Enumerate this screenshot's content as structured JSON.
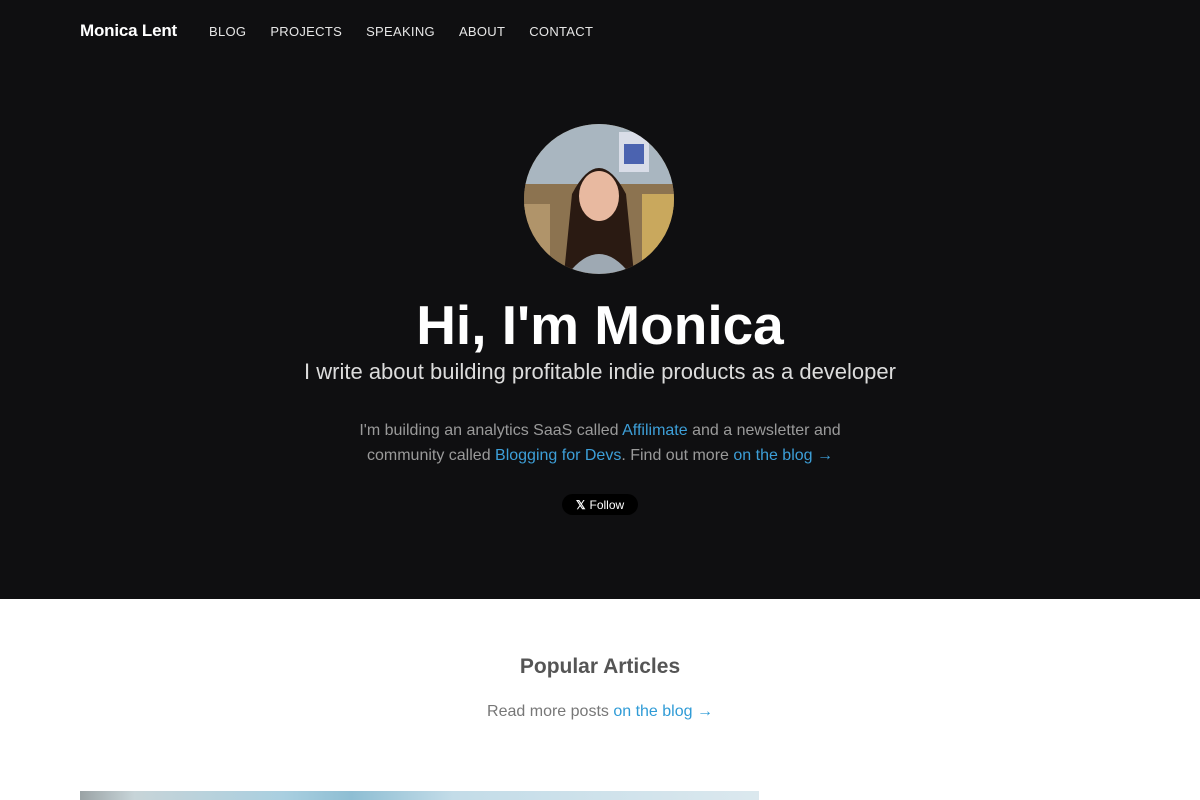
{
  "nav": {
    "brand": "Monica Lent",
    "links": [
      "BLOG",
      "PROJECTS",
      "SPEAKING",
      "ABOUT",
      "CONTACT"
    ]
  },
  "hero": {
    "title": "Hi, I'm Monica",
    "subtitle": "I write about building profitable indie products as a developer",
    "desc": {
      "p1": "I'm building an analytics SaaS called ",
      "link1": "Affilimate",
      "p2": " and a newsletter and community called ",
      "link2": "Blogging for Devs",
      "p3": ". Find out more ",
      "link3": "on the blog →"
    },
    "follow": {
      "icon": "x-logo-icon",
      "glyph": "𝕏",
      "label": "Follow"
    }
  },
  "popular": {
    "title": "Popular Articles",
    "more_text": "Read more posts ",
    "more_link": "on the blog →"
  },
  "colors": {
    "hero_bg": "#0f0f11",
    "link": "#3d9fd8"
  }
}
